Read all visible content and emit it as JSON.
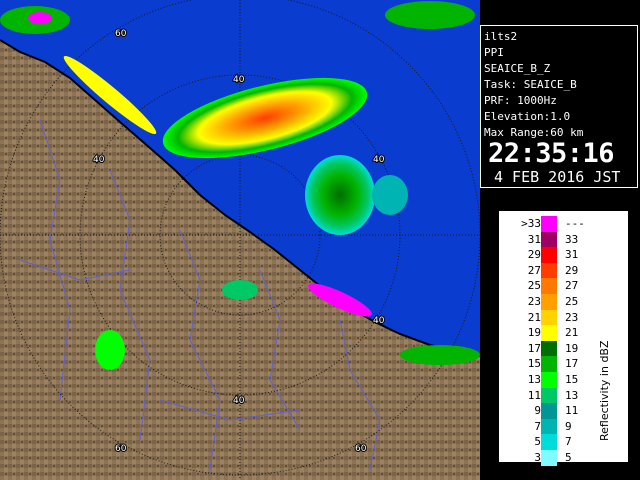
{
  "map": {
    "ring_labels": [
      "60",
      "40",
      "40",
      "40",
      "40",
      "40",
      "60",
      "60"
    ],
    "colors": {
      "sea": "#0a3cd0",
      "land": "#8c7455",
      "land_dark": "#6e5a40",
      "outer": "#ffffff",
      "coast": "#000000",
      "ring": "#1a1a1a",
      "rivers": "#6060d0"
    }
  },
  "info": {
    "radar": "ilts2",
    "mode": "PPI",
    "product": "SEAICE_B_Z",
    "task": "Task: SEAICE_B",
    "prf": "PRF: 1000Hz",
    "elevation": "Elevation:1.0",
    "max_range": "Max Range:60 km",
    "time": "22:35:16",
    "date": "4 FEB 2016 JST"
  },
  "legend": {
    "title": "Reflectivity in dBZ",
    "rows": [
      {
        "lo": ">33",
        "hi": "---",
        "color": "#ff00ff"
      },
      {
        "lo": "31",
        "hi": "33",
        "color": "#a00064"
      },
      {
        "lo": "29",
        "hi": "31",
        "color": "#ff0000"
      },
      {
        "lo": "27",
        "hi": "29",
        "color": "#ff3c00"
      },
      {
        "lo": "25",
        "hi": "27",
        "color": "#ff7800"
      },
      {
        "lo": "23",
        "hi": "25",
        "color": "#ffa000"
      },
      {
        "lo": "21",
        "hi": "23",
        "color": "#ffd200"
      },
      {
        "lo": "19",
        "hi": "21",
        "color": "#ffff00"
      },
      {
        "lo": "17",
        "hi": "19",
        "color": "#006e00"
      },
      {
        "lo": "15",
        "hi": "17",
        "color": "#00b400"
      },
      {
        "lo": "13",
        "hi": "15",
        "color": "#00ff00"
      },
      {
        "lo": "11",
        "hi": "13",
        "color": "#00c864"
      },
      {
        "lo": "9",
        "hi": "11",
        "color": "#009696"
      },
      {
        "lo": "7",
        "hi": "9",
        "color": "#00b4b4"
      },
      {
        "lo": "5",
        "hi": "7",
        "color": "#00dcdc"
      },
      {
        "lo": "3",
        "hi": "5",
        "color": "#7ffcff"
      }
    ]
  }
}
